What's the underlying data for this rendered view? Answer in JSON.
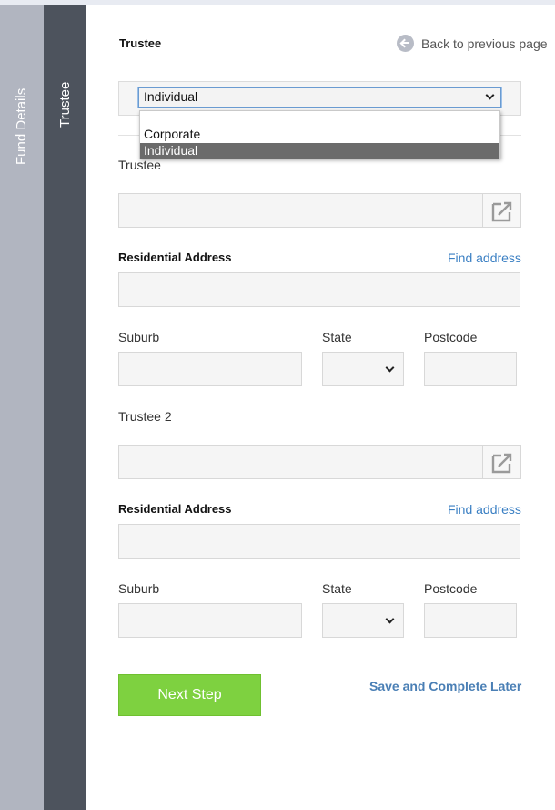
{
  "sidebar": {
    "fund_details_label": "Fund Details",
    "trustee_label": "Trustee"
  },
  "header": {
    "title": "Trustee",
    "back_link": "Back to previous page"
  },
  "trustee_type": {
    "selected": "Individual",
    "options": [
      "Corporate",
      "Individual"
    ]
  },
  "trustee1": {
    "label": "Trustee",
    "name_value": "",
    "address_label": "Residential Address",
    "find_address": "Find address",
    "suburb_label": "Suburb",
    "state_label": "State",
    "postcode_label": "Postcode"
  },
  "trustee2": {
    "label": "Trustee 2",
    "name_value": "",
    "address_label": "Residential Address",
    "find_address": "Find address",
    "suburb_label": "Suburb",
    "state_label": "State",
    "postcode_label": "Postcode"
  },
  "actions": {
    "next_step": "Next Step",
    "save_later": "Save and Complete Later"
  }
}
